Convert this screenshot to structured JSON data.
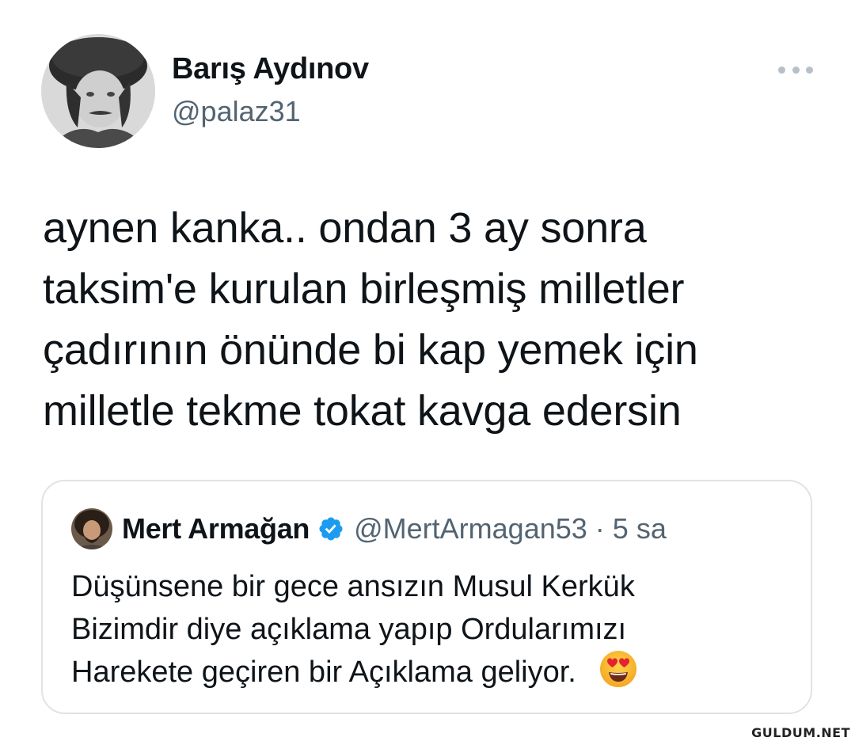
{
  "tweet": {
    "author": {
      "display_name": "Barış Aydınov",
      "handle": "@palaz31",
      "avatar_icon": "profile-photo"
    },
    "more_icon": "more-dots-icon",
    "text_lines": [
      "aynen kanka.. ondan 3 ay sonra",
      "taksim'e kurulan birleşmiş milletler",
      "çadırının önünde bi kap yemek için",
      "milletle tekme tokat kavga edersin"
    ]
  },
  "quoted_tweet": {
    "author": {
      "display_name": "Mert Armağan",
      "handle": "@MertArmagan53",
      "verified_icon": "verified-badge-icon"
    },
    "separator": "·",
    "time": "5 sa",
    "text_lines": [
      "Düşünsene bir gece ansızın Musul Kerkük",
      "Bizimdir diye açıklama yapıp Ordularımızı",
      "Harekete geçiren bir Açıklama geliyor."
    ],
    "emoji_icon": "heart-eyes-emoji-icon"
  },
  "watermark": "GULDUM.NET",
  "colors": {
    "text": "#0f1419",
    "secondary": "#536471",
    "verified": "#1d9bf0",
    "border": "#dfe3e7"
  }
}
